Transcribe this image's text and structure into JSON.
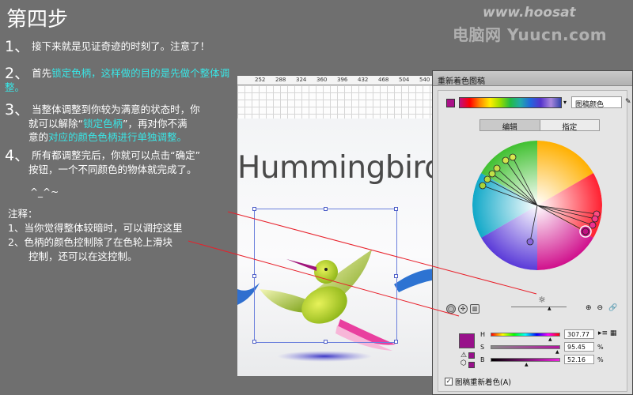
{
  "tutorial": {
    "title": "第四步",
    "step1": {
      "num": "1、",
      "text": "接下来就是见证奇迹的时刻了。注意了！"
    },
    "step2": {
      "num": "2、",
      "prefix": "首先",
      "highlight": "锁定色柄，这样做的目的是先做个整体调整",
      "suffix": "。"
    },
    "step3": {
      "num": "3、",
      "line1": "当整体调整到你较为满意的状态时，你",
      "line2_a": "就可以解除“",
      "line2_hl": "锁定色柄",
      "line2_b": "”，再对你不满",
      "line3_a": "意的",
      "line3_hl": "对应的颜色色柄进行单独调整。"
    },
    "step4": {
      "num": "4、",
      "line1": "所有都调整完后，你就可以点击“确定”",
      "line2": "按钮，一个不同颜色的物体就完成了。"
    },
    "smiley": "^_^~",
    "note": {
      "heading": "注释：",
      "item1": "1、当你觉得整体较暗时，可以调控这里",
      "item2": "2、色柄的颜色控制除了在色轮上滑块",
      "item3": "控制，还可以在这控制。"
    }
  },
  "watermark": {
    "main": "电脑网 Yuucn.com",
    "top": "www.hoosat"
  },
  "document": {
    "ruler_labels": [
      "252",
      "288",
      "324",
      "360",
      "396",
      "432",
      "468",
      "504",
      "540"
    ],
    "artwork_title": "Hummingbird"
  },
  "dialog": {
    "title": "重新着色图稿",
    "preset_name": "图稿颜色",
    "tab_edit": "编辑",
    "tab_assign": "指定",
    "hsb": [
      {
        "label": "H",
        "value": "307.77",
        "unit": "°",
        "fill": 0.855
      },
      {
        "label": "S",
        "value": "95.45",
        "unit": "%",
        "fill": 0.9545
      },
      {
        "label": "B",
        "value": "52.16",
        "unit": "%",
        "fill": 0.5216
      }
    ],
    "current_color": "#98108a",
    "recolor_label": "图稿重新着色(A)",
    "recolor_checked": true
  },
  "colors": {
    "background": "#6f6f6f",
    "highlight": "#39e6e6",
    "callout_line": "#e8202a",
    "selection": "#6a7fdc"
  },
  "icons": [
    "eyedropper-icon",
    "sun-icon",
    "lock-icon",
    "add-color-icon",
    "warning-icon",
    "cube-icon",
    "check-icon"
  ]
}
